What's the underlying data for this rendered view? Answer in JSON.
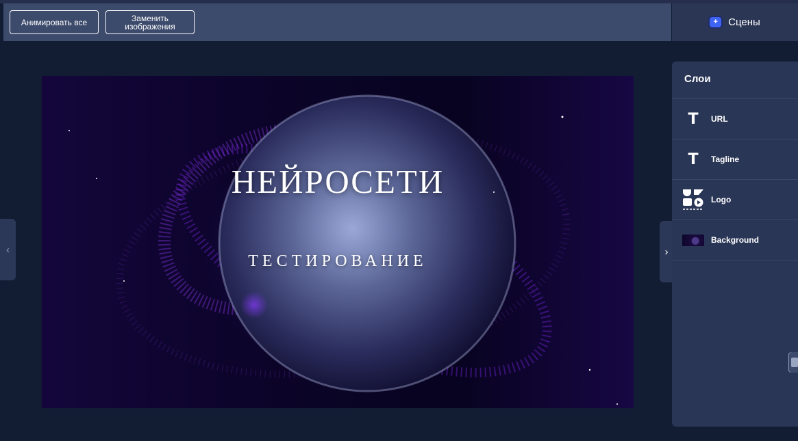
{
  "toolbar": {
    "animate_all_label": "Анимировать все",
    "replace_images_label": "Заменить изображения"
  },
  "scenes_tab": {
    "label": "Сцены",
    "icon": "plus-square-icon",
    "icon_glyph": "+",
    "accent": "#3f63f3"
  },
  "preview": {
    "title": "НЕЙРОСЕТИ",
    "tagline": "ТЕСТИРОВАНИЕ"
  },
  "nav": {
    "collapse_left_glyph": "‹",
    "collapse_right_glyph": "›"
  },
  "layers_panel": {
    "title": "Слои",
    "items": [
      {
        "label": "URL",
        "icon": "text-icon",
        "glyph": "T"
      },
      {
        "label": "Tagline",
        "icon": "text-icon",
        "glyph": "T"
      },
      {
        "label": "Logo",
        "icon": "shapes-icon"
      },
      {
        "label": "Background",
        "icon": "image-thumbnail"
      }
    ]
  },
  "colors": {
    "background": "#121c33",
    "toolbar": "#3c4a6b",
    "panel": "#2a3656"
  }
}
